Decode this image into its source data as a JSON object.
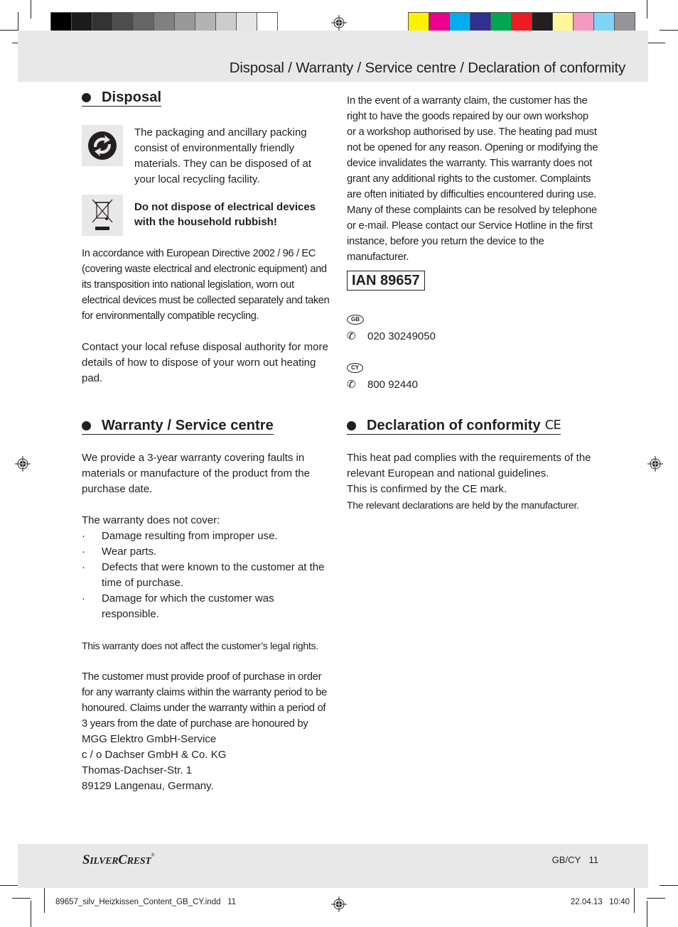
{
  "header": {
    "title": "Disposal / Warranty / Service centre / Declaration of conformity"
  },
  "print_marks": {
    "gray_swatches": [
      "#000000",
      "#1c1c1c",
      "#333333",
      "#4d4d4d",
      "#666666",
      "#808080",
      "#999999",
      "#b3b3b3",
      "#cccccc",
      "#e6e6e6",
      "#ffffff"
    ],
    "color_swatches": [
      "#fff200",
      "#ec008c",
      "#00aeef",
      "#2e3192",
      "#00a651",
      "#ed1c24",
      "#231f20",
      "#fff799",
      "#f49ac1",
      "#7fd3f7",
      "#939598"
    ]
  },
  "disposal": {
    "heading": "Disposal",
    "packaging_icon": "green-dot-recycling-icon",
    "packaging_text": "The packaging and ancillary packing consist of environmentally friendly materials. They can be disposed of at your local recycling facility.",
    "weee_icon": "crossed-out-wheelie-bin-icon",
    "weee_warning": "Do not dispose of electrical devices with the household rubbish!",
    "directive_text": "In accordance with European Directive 2002 / 96 / EC (covering waste electrical and electronic equipment) and its transposition into national legislation, worn out electrical devices must be collected separately and taken for environmentally compatible recycling.",
    "contact_text": "Contact your local refuse disposal authority for more details of how to dispose of your worn out heating pad."
  },
  "warranty": {
    "heading": "Warranty / Service centre",
    "intro": "We provide a 3-year warranty covering faults in materials or manufacture of the product from the purchase date.",
    "not_cover_label": "The warranty does not cover:",
    "exclusions": [
      "Damage resulting from improper use.",
      "Wear parts.",
      "Defects that were known to the customer at the time of purchase.",
      "Damage for which the customer was responsible."
    ],
    "legal_rights": "This warranty does not affect the customer’s legal rights.",
    "proof_text": "The customer must provide proof of purchase in order for any warranty claims within the warranty period to be honoured. Claims under the warranty within a period of 3 years from the date of purchase are honoured by",
    "address": [
      "MGG Elektro GmbH-Service",
      "c / o Dachser GmbH & Co. KG",
      "Thomas-Dachser-Str. 1",
      "89129 Langenau, Germany."
    ],
    "claim_text": "In the event of a warranty claim, the customer has the right to have the goods repaired by our own workshop or a workshop authorised by use. The heating pad must not be opened for any reason. Opening or modifying the device invalidates the warranty. This warranty does not grant any additional rights to the customer. Complaints are often initiated by difficulties encountered during use. Many of these complaints can be resolved by telephone or e-mail. Please contact our Service Hotline in the first instance, before you return the device to the manufacturer.",
    "ian": "IAN 89657",
    "hotlines": [
      {
        "country": "GB",
        "phone": "020 30249050"
      },
      {
        "country": "CY",
        "phone": "800 92440"
      }
    ]
  },
  "conformity": {
    "heading": "Declaration of conformity",
    "ce_mark": "CE",
    "lines": [
      "This heat pad complies with the requirements of the relevant European and national guidelines.",
      "This is confirmed by the CE mark."
    ],
    "last_line": "The relevant declarations are held by the manufacturer."
  },
  "footer": {
    "brand_s": "S",
    "brand_ilver": "ILVER",
    "brand_c": "C",
    "brand_rest": "REST",
    "brand_reg": "®",
    "page_label": "GB/CY 11",
    "slug_file": "89657_silv_Heizkissen_Content_GB_CY.indd   11",
    "slug_date": "22.04.13   10:40"
  }
}
